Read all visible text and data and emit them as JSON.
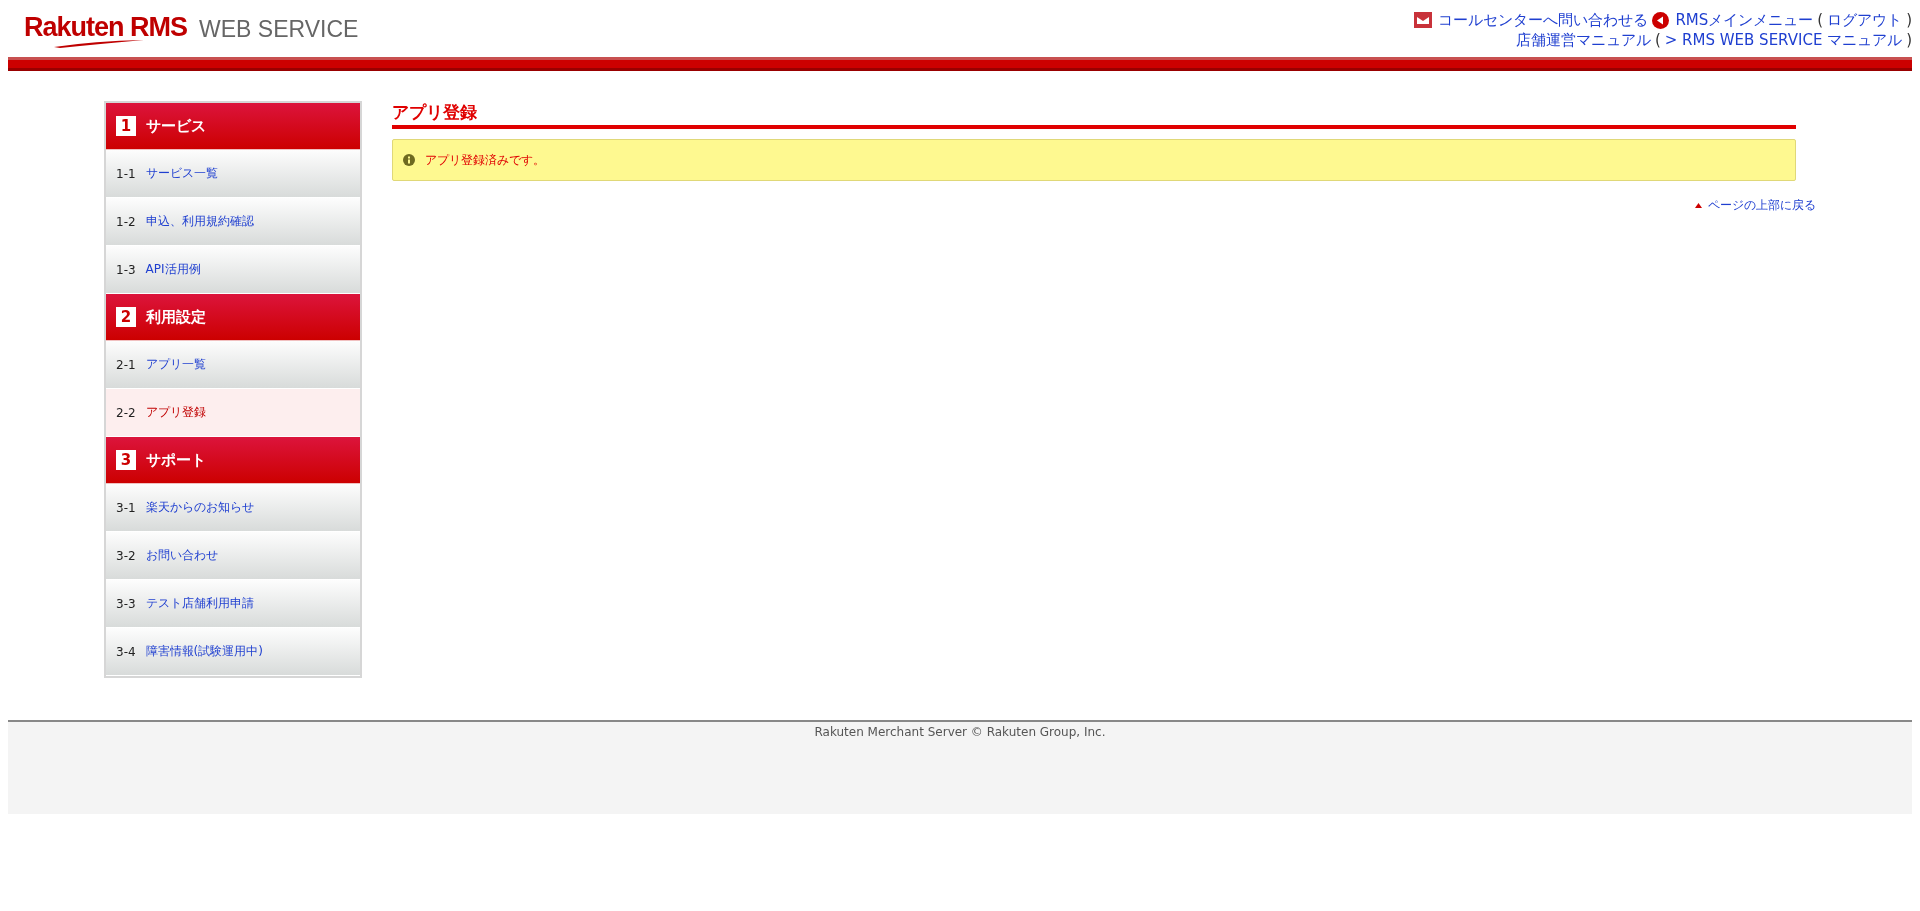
{
  "header": {
    "logo": {
      "brand": "Rakuten RMS",
      "product": "WEB SERVICE"
    },
    "lines": [
      [
        {
          "kind": "mail",
          "text": "コールセンターへ問い合わせる"
        },
        {
          "kind": "back",
          "text": "RMSメインメニュー"
        },
        {
          "kind": "text",
          "text": "("
        },
        {
          "kind": "link",
          "text": "ログアウト"
        },
        {
          "kind": "text",
          "text": ")"
        }
      ],
      [
        {
          "kind": "link",
          "text": "店舗運営マニュアル"
        },
        {
          "kind": "text",
          "text": "("
        },
        {
          "kind": "link",
          "text": "> RMS WEB SERVICE マニュアル"
        },
        {
          "kind": "text",
          "text": ")"
        }
      ]
    ]
  },
  "sidebar": {
    "sections": [
      {
        "number": "1",
        "title": "サービス",
        "items": [
          {
            "number": "1-1",
            "label": "サービス一覧",
            "selected": false
          },
          {
            "number": "1-2",
            "label": "申込、利用規約確認",
            "selected": false
          },
          {
            "number": "1-3",
            "label": "API活用例",
            "selected": false
          }
        ]
      },
      {
        "number": "2",
        "title": "利用設定",
        "items": [
          {
            "number": "2-1",
            "label": "アプリ一覧",
            "selected": false
          },
          {
            "number": "2-2",
            "label": "アプリ登録",
            "selected": true
          }
        ]
      },
      {
        "number": "3",
        "title": "サポート",
        "items": [
          {
            "number": "3-1",
            "label": "楽天からのお知らせ",
            "selected": false
          },
          {
            "number": "3-2",
            "label": "お問い合わせ",
            "selected": false
          },
          {
            "number": "3-3",
            "label": "テスト店舗利用申請",
            "selected": false
          },
          {
            "number": "3-4",
            "label": "障害情報(試験運用中)",
            "selected": false
          }
        ]
      }
    ]
  },
  "content": {
    "title": "アプリ登録",
    "alert": "アプリ登録済みです。",
    "back_to_top": "ページの上部に戻る"
  },
  "footer": {
    "copyright": "Rakuten Merchant Server © Rakuten Group, Inc."
  }
}
